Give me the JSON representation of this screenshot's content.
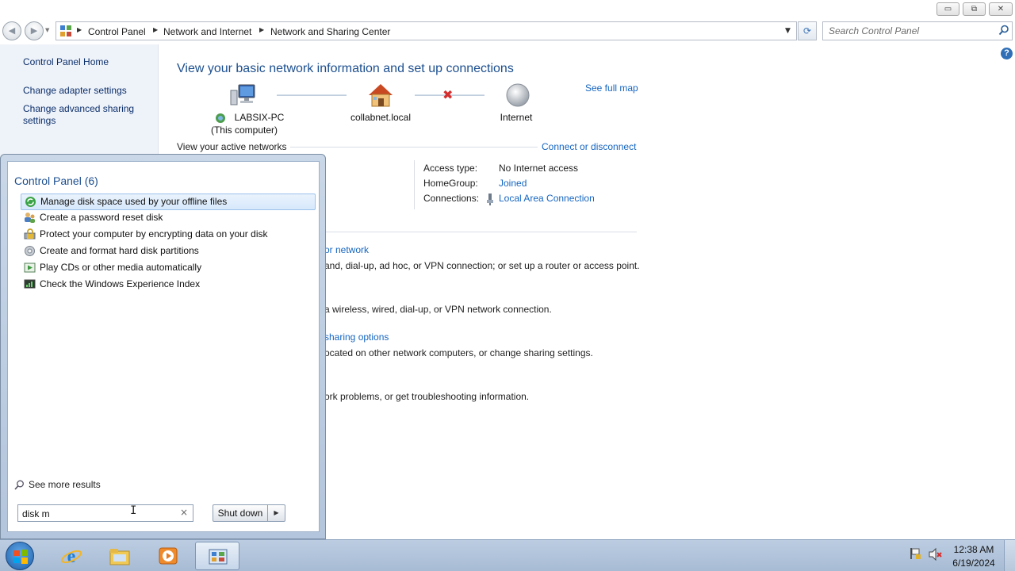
{
  "window": {
    "controls": {
      "minimize": "▭",
      "maximize": "⧉",
      "close": "✕"
    }
  },
  "navigation": {
    "back_glyph": "◀",
    "forward_glyph": "▶",
    "recent_glyph": "▼",
    "breadcrumb_separator": "▶",
    "breadcrumbs": [
      "Control Panel",
      "Network and Internet",
      "Network and Sharing Center"
    ],
    "dropdown_glyph": "▼",
    "refresh_glyph": "⟳",
    "search_placeholder": "Search Control Panel"
  },
  "left_pane": {
    "links": [
      "Control Panel Home",
      "Change adapter settings",
      "Change advanced sharing settings"
    ]
  },
  "content": {
    "help_glyph": "?",
    "title": "View your basic network information and set up connections",
    "see_full_map": "See full map",
    "map_nodes": [
      {
        "name": "LABSIX-PC",
        "sub": "(This computer)",
        "icon": "computer-icon"
      },
      {
        "name": "collabnet.local",
        "sub": "",
        "icon": "house-icon"
      },
      {
        "name": "Internet",
        "sub": "",
        "icon": "globe-icon"
      }
    ],
    "broken_link_glyph": "✖",
    "active_networks_label": "View your active networks",
    "connect_or_disconnect": "Connect or disconnect",
    "network_properties": {
      "access_type_label": "Access type:",
      "access_type_value": "No Internet access",
      "homegroup_label": "HomeGroup:",
      "homegroup_value": "Joined",
      "connections_label": "Connections:",
      "connections_value": "Local Area Connection"
    },
    "visible_fragments": [
      {
        "text": "or network",
        "kind": "link"
      },
      {
        "text": "and, dial-up, ad hoc, or VPN connection; or set up a router or access point.",
        "kind": "text"
      },
      {
        "text": "a wireless, wired, dial-up, or VPN network connection.",
        "kind": "text"
      },
      {
        "text": "sharing options",
        "kind": "link"
      },
      {
        "text": "ocated on other network computers, or change sharing settings.",
        "kind": "text"
      },
      {
        "text": "ork problems, or get troubleshooting information.",
        "kind": "text"
      }
    ]
  },
  "start_menu": {
    "results_heading": "Control Panel (6)",
    "results": [
      {
        "label": "Manage disk space used by your offline files",
        "icon": "sync-center-icon",
        "highlighted": true
      },
      {
        "label": "Create a password reset disk",
        "icon": "user-accounts-icon",
        "highlighted": false
      },
      {
        "label": "Protect your computer by encrypting data on your disk",
        "icon": "bitlocker-icon",
        "highlighted": false
      },
      {
        "label": "Create and format hard disk partitions",
        "icon": "admin-tools-icon",
        "highlighted": false
      },
      {
        "label": "Play CDs or other media automatically",
        "icon": "autoplay-icon",
        "highlighted": false
      },
      {
        "label": "Check the Windows Experience Index",
        "icon": "performance-icon",
        "highlighted": false
      }
    ],
    "see_more": "See more results",
    "search_value": "disk m",
    "clear_glyph": "×",
    "shutdown_label": "Shut down",
    "shutdown_arrow": "▶",
    "text_cursor_glyph": "I"
  },
  "taskbar": {
    "buttons": [
      {
        "name": "internet-explorer",
        "icon": "ie-icon",
        "active": false
      },
      {
        "name": "windows-explorer",
        "icon": "folder-icon",
        "active": false
      },
      {
        "name": "media-player",
        "icon": "media-player-icon",
        "active": false
      },
      {
        "name": "control-panel",
        "icon": "control-panel-icon",
        "active": true
      }
    ],
    "clock_time": "12:38 AM",
    "clock_date": "6/19/2024"
  },
  "colors": {
    "link": "#1565c0",
    "title": "#1c4f8f",
    "left_pane_bg": "#eef2f9",
    "taskbar": "#b3c5dc",
    "error_red": "#d32f2f"
  }
}
